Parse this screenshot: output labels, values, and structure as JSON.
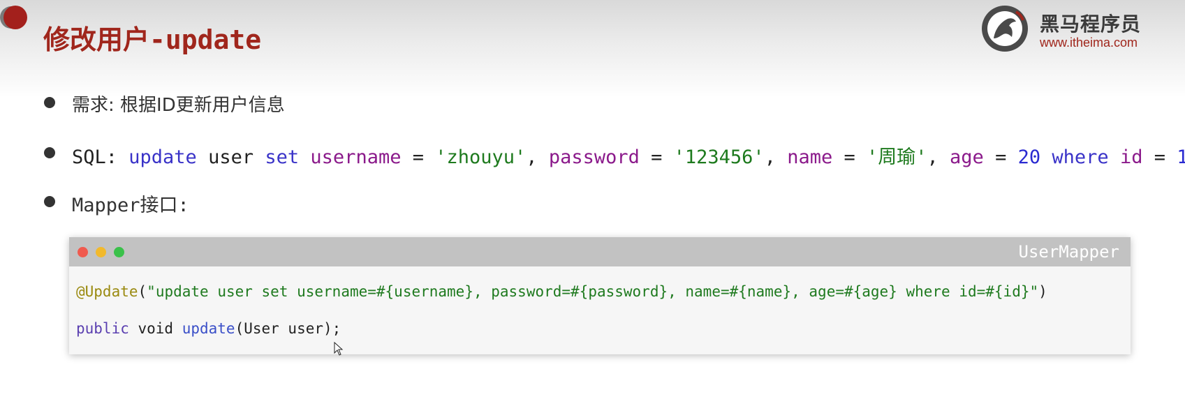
{
  "slide": {
    "title": "修改用户-update"
  },
  "logo": {
    "name": "黑马程序员",
    "url": "www.itheima.com",
    "accent": "#a0261c"
  },
  "bullets": {
    "req_label": "需求: 根据ID更新用户信息",
    "sql_label": "SQL: ",
    "sql": {
      "t1": "update",
      "t2": " user ",
      "t3": "set",
      "t4": " ",
      "t5": "username",
      "t6": " = ",
      "t7": "'zhouyu'",
      "t8": ", ",
      "t9": "password",
      "t10": " = ",
      "t11": "'123456'",
      "t12": ", ",
      "t13": "name",
      "t14": " = ",
      "t15": "'周瑜'",
      "t16": ", ",
      "t17": "age",
      "t18": " = ",
      "t19": "20",
      "t20": " ",
      "t21": "where",
      "t22": " ",
      "t23": "id",
      "t24": " = ",
      "t25": "1",
      "t26": ";"
    },
    "mapper_label": "Mapper接口:"
  },
  "code_window": {
    "title": "UserMapper",
    "line1": {
      "annotation": "@Update",
      "open": "(",
      "string": "\"update user set username=#{username}, password=#{password}, name=#{name}, age=#{age} where id=#{id}\"",
      "close": ")"
    },
    "line2": {
      "kw_public": "public",
      "plain1": " void ",
      "fn": "update",
      "plain2": "(User user);"
    }
  },
  "icons": [
    "window-close-dot",
    "window-minimize-dot",
    "window-maximize-dot",
    "mouse-pointer-icon",
    "horse-logo-icon"
  ]
}
